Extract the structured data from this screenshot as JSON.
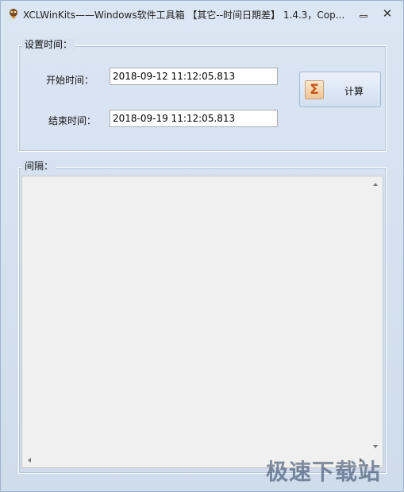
{
  "window": {
    "title": "XCLWinKits——Windows软件工具箱 【其它--时间日期差】 1.4.3，Cop...",
    "icons": {
      "app": "app-icon",
      "minimize": "minimize-icon",
      "close": "close-icon"
    },
    "close_glyph": "✕"
  },
  "settings": {
    "legend": "设置时间：",
    "start_label": "开始时间：",
    "start_value": "2018-09-12 11:12:05.813",
    "end_label": "结束时间：",
    "end_value": "2018-09-19 11:12:05.813",
    "calc_button": {
      "icon": "sigma-icon",
      "glyph": "Σ",
      "label": "计算"
    }
  },
  "interval": {
    "legend": "间隔：",
    "value": ""
  },
  "watermark": "极速下载站",
  "colors": {
    "window_bg": "#d5e1ef",
    "sigma_accent": "#c4561a",
    "result_bg": "#f0f0f0"
  }
}
